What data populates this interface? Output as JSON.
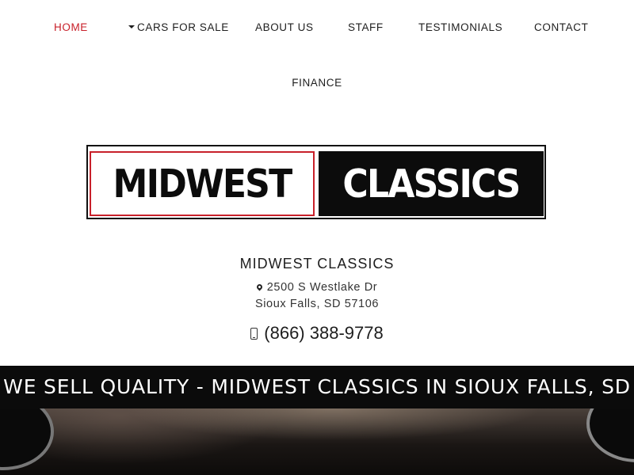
{
  "nav": {
    "items": [
      {
        "label": "HOME",
        "active": true
      },
      {
        "label": "CARS FOR SALE",
        "has_dropdown": true
      },
      {
        "label": "ABOUT US"
      },
      {
        "label": "STAFF"
      },
      {
        "label": "TESTIMONIALS"
      },
      {
        "label": "CONTACT"
      },
      {
        "label": "FINANCE"
      }
    ]
  },
  "logo": {
    "word1": "MIDWEST",
    "word2": "CLASSICS"
  },
  "business": {
    "name": "MIDWEST CLASSICS",
    "address_line1": "2500 S Westlake Dr",
    "address_line2": "Sioux Falls, SD 57106",
    "phone": "(866) 388-9778",
    "address_icon": "map-marker-icon",
    "phone_icon": "mobile-phone-icon"
  },
  "banner": {
    "text": "WE SELL QUALITY - MIDWEST CLASSICS IN SIOUX FALLS, SD"
  },
  "colors": {
    "accent": "#c8202a",
    "banner_bg": "#0b0b0b"
  }
}
